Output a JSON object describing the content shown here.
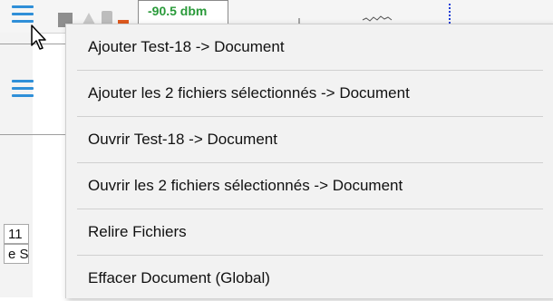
{
  "toolbar": {
    "signal_readout": "-90.5 dbm"
  },
  "side_cells": {
    "cell_1": "11",
    "cell_2": "e S"
  },
  "context_menu": {
    "items": [
      {
        "label": "Ajouter Test-18 -> Document"
      },
      {
        "label": "Ajouter les 2 fichiers sélectionnés -> Document"
      },
      {
        "label": "Ouvrir Test-18 -> Document"
      },
      {
        "label": "Ouvrir les 2 fichiers sélectionnés -> Document"
      },
      {
        "label": "Relire Fichiers"
      },
      {
        "label": "Effacer Document (Global)"
      }
    ]
  },
  "colors": {
    "menu_bg": "#f2f2f2",
    "accent_blue": "#2f8fd8",
    "signal_green": "#2a9a3a",
    "orange": "#e05a1e"
  },
  "icons": [
    "hamburger-menu-icon",
    "stop-icon",
    "warning-icon",
    "lock-icon",
    "mouse-pointer-icon"
  ]
}
